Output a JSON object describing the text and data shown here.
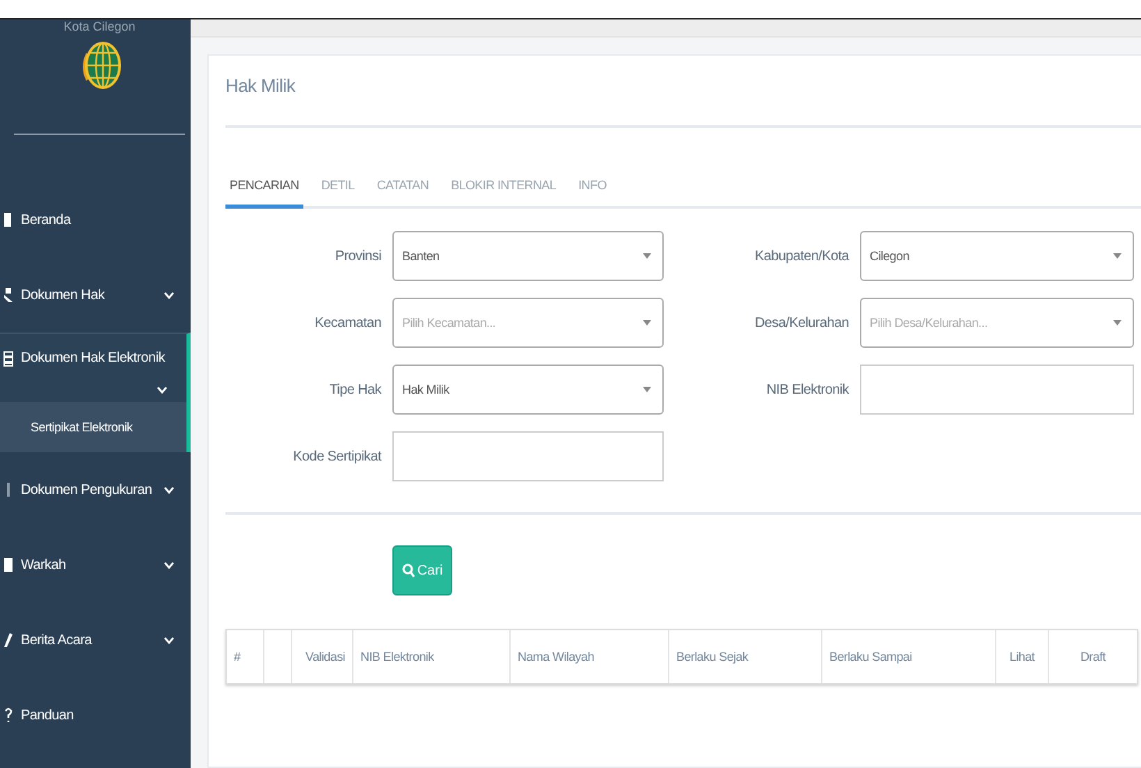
{
  "sidebar": {
    "logo_caption": "Kota Cilegon",
    "items": [
      {
        "label": "Beranda",
        "kind": "link",
        "selected": false
      },
      {
        "label": "Dokumen Hak",
        "kind": "group",
        "selected": false,
        "expanded": false
      },
      {
        "label": "Dokumen Hak Elektronik",
        "kind": "group",
        "selected": true,
        "expanded": true,
        "children": [
          {
            "label": "Sertipikat Elektronik",
            "selected": true
          }
        ]
      },
      {
        "label": "Dokumen Pengukuran",
        "kind": "group",
        "selected": false,
        "expanded": false
      },
      {
        "label": "Warkah",
        "kind": "group",
        "selected": false,
        "expanded": false
      },
      {
        "label": "Berita Acara",
        "kind": "group",
        "selected": false,
        "expanded": false
      },
      {
        "label": "Panduan",
        "kind": "link",
        "selected": false
      }
    ]
  },
  "panel": {
    "title": "Hak Milik",
    "tabs": [
      {
        "label": "PENCARIAN",
        "selected": true
      },
      {
        "label": "DETIL",
        "selected": false
      },
      {
        "label": "CATATAN",
        "selected": false
      },
      {
        "label": "BLOKIR INTERNAL",
        "selected": false
      },
      {
        "label": "INFO",
        "selected": false
      }
    ],
    "form_left": [
      {
        "label": "Provinsi",
        "kind": "select",
        "value": "Banten"
      },
      {
        "label": "Kecamatan",
        "kind": "select",
        "placeholder": "Pilih Kecamatan..."
      },
      {
        "label": "Tipe Hak",
        "kind": "select",
        "value": "Hak Milik"
      },
      {
        "label": "Kode Sertipikat",
        "kind": "text"
      }
    ],
    "form_right": [
      {
        "label": "Kabupaten/Kota",
        "kind": "select",
        "value": "Cilegon"
      },
      {
        "label": "Desa/Kelurahan",
        "kind": "select",
        "placeholder": "Pilih Desa/Kelurahan..."
      },
      {
        "label": "NIB Elektronik",
        "kind": "text"
      }
    ],
    "search_button": "Cari",
    "table": {
      "columns": [
        "#",
        "Validasi",
        "NIB Elektronik",
        "Nama Wilayah",
        "Berlaku Sejak",
        "Berlaku Sampai",
        "Lihat",
        "Draft"
      ]
    }
  }
}
